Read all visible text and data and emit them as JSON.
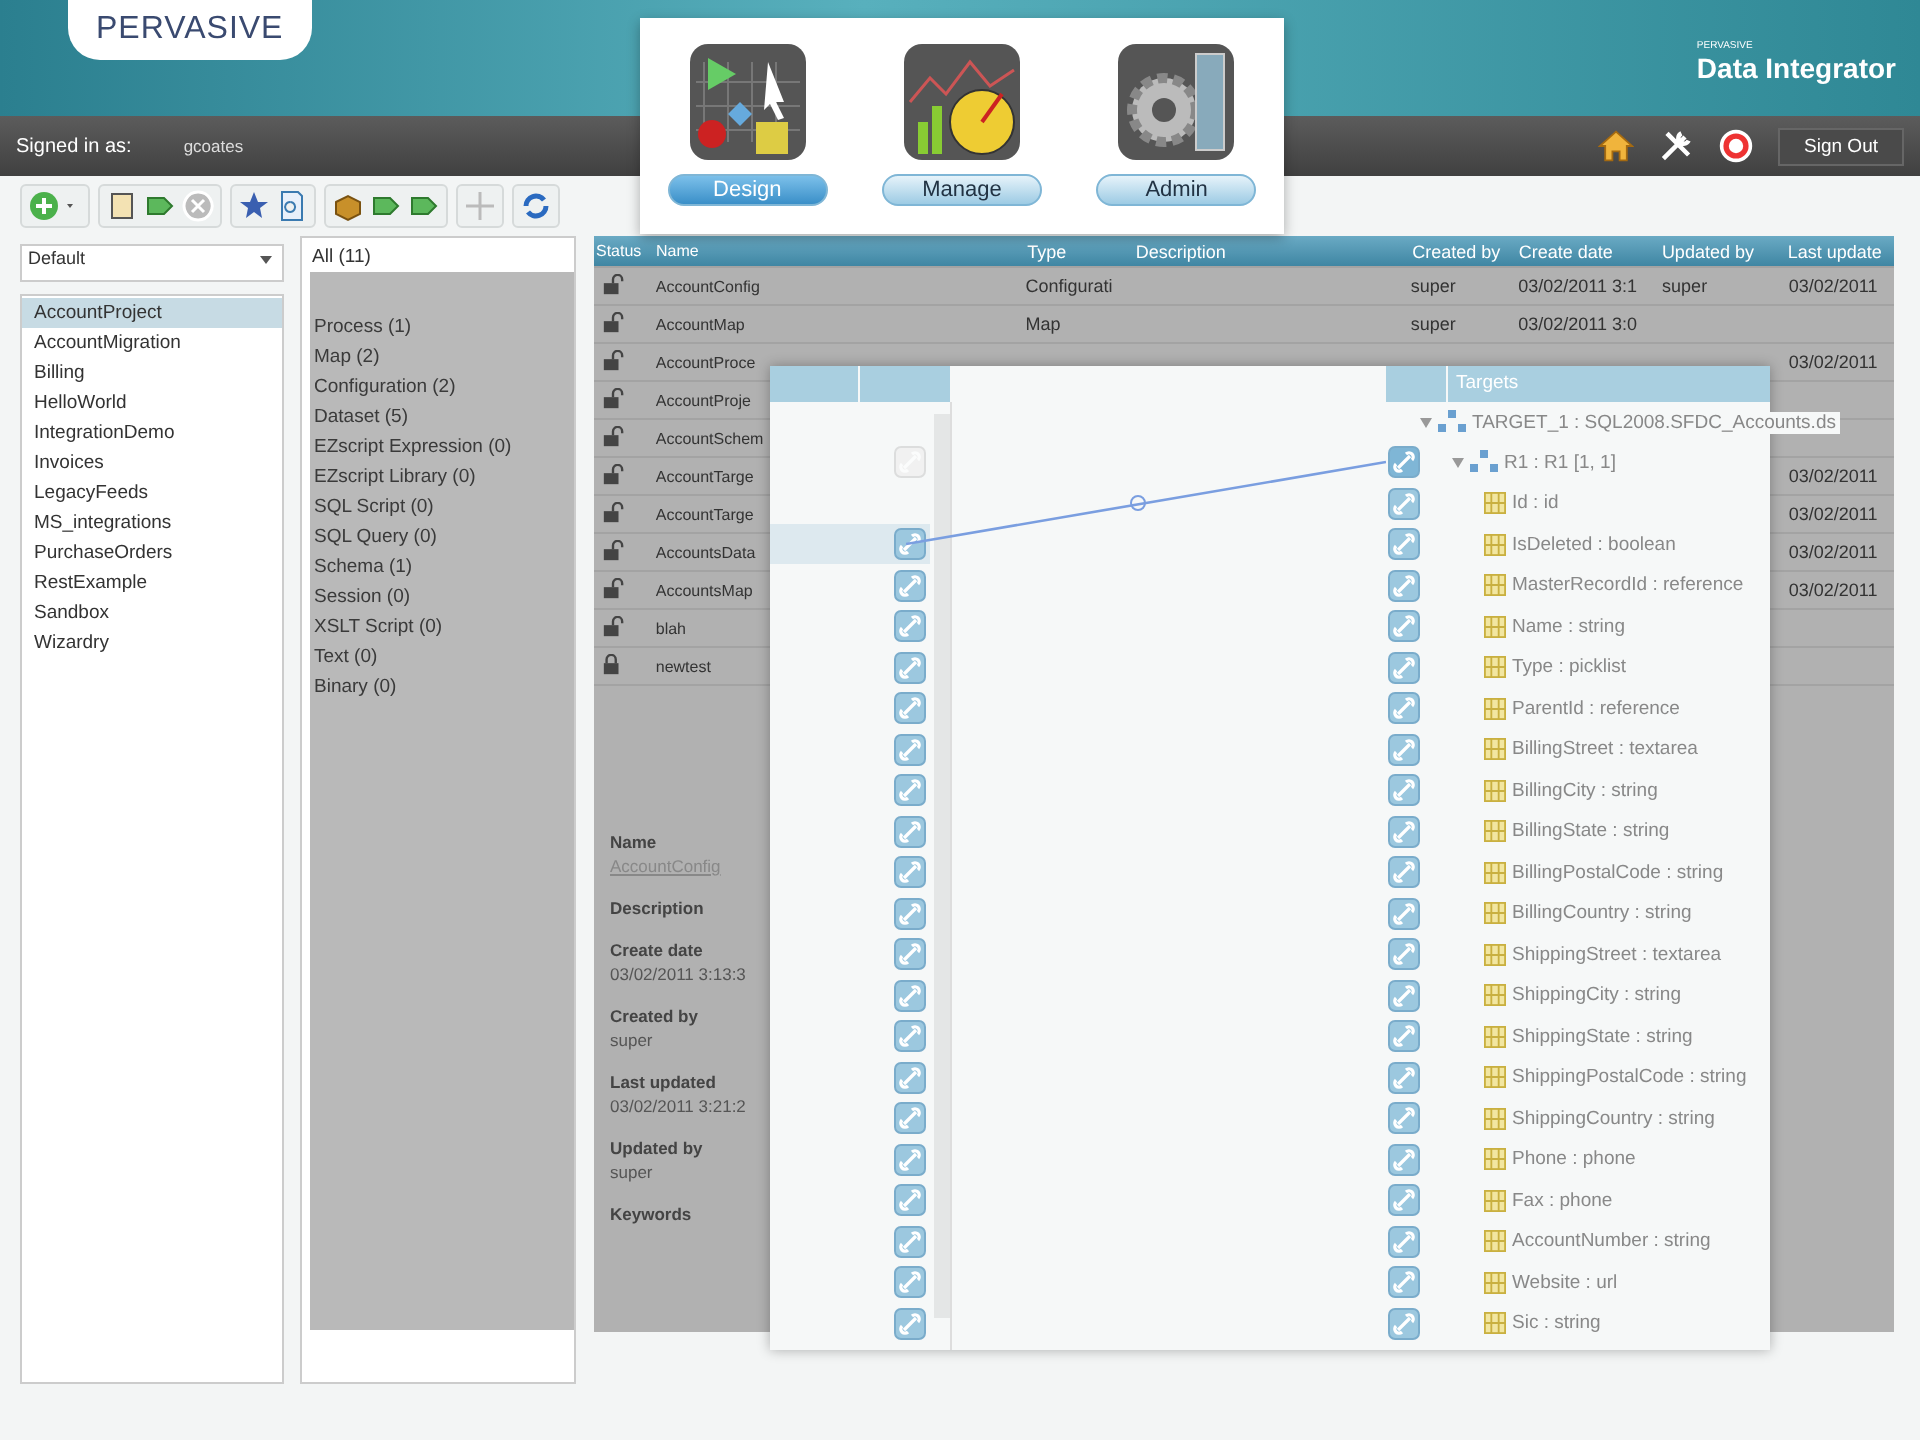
{
  "header": {
    "logo": "PERVASIVE",
    "product_brand": "PERVASIVE",
    "product": "Data Integrator"
  },
  "app_switcher": [
    {
      "label": "Design",
      "kind": "design",
      "selected": true
    },
    {
      "label": "Manage",
      "kind": "manage",
      "selected": false
    },
    {
      "label": "Admin",
      "kind": "admin",
      "selected": false
    }
  ],
  "user_bar": {
    "label": "Signed in as:",
    "user": "gcoates",
    "sign_out": "Sign Out"
  },
  "project_filter": "Default",
  "projects": [
    {
      "label": "AccountProject",
      "selected": true
    },
    {
      "label": "AccountMigration",
      "selected": false
    },
    {
      "label": "Billing",
      "selected": false
    },
    {
      "label": "HelloWorld",
      "selected": false
    },
    {
      "label": "IntegrationDemo",
      "selected": false
    },
    {
      "label": "Invoices",
      "selected": false
    },
    {
      "label": "LegacyFeeds",
      "selected": false
    },
    {
      "label": "MS_integrations",
      "selected": false
    },
    {
      "label": "PurchaseOrders",
      "selected": false
    },
    {
      "label": "RestExample",
      "selected": false
    },
    {
      "label": "Sandbox",
      "selected": false
    },
    {
      "label": "Wizardry",
      "selected": false
    }
  ],
  "categories": {
    "all": "All (11)",
    "items": [
      "Process (1)",
      "Map (2)",
      "Configuration (2)",
      "Dataset (5)",
      "EZscript Expression (0)",
      "EZscript Library (0)",
      "SQL Script (0)",
      "SQL Query (0)",
      "Schema (1)",
      "Session (0)",
      "XSLT Script (0)",
      "Text (0)",
      "Binary (0)"
    ]
  },
  "table": {
    "columns": [
      "Status",
      "Name",
      "Type",
      "Description",
      "Created by",
      "Create date",
      "Updated by",
      "Last update"
    ],
    "rows": [
      {
        "locked": false,
        "name": "AccountConfig",
        "type": "Configurati",
        "created_by": "super",
        "create_date": "03/02/2011 3:1",
        "updated_by": "super",
        "last_updated": "03/02/2011"
      },
      {
        "locked": false,
        "name": "AccountMap",
        "type": "Map",
        "created_by": "super",
        "create_date": "03/02/2011 3:0"
      },
      {
        "locked": false,
        "name": "AccountProce",
        "last_updated": "03/02/2011"
      },
      {
        "locked": false,
        "name": "AccountProje"
      },
      {
        "locked": false,
        "name": "AccountSchem"
      },
      {
        "locked": false,
        "name": "AccountTarge",
        "last_updated": "03/02/2011"
      },
      {
        "locked": false,
        "name": "AccountTarge",
        "last_updated": "03/02/2011"
      },
      {
        "locked": false,
        "name": "AccountsData",
        "last_updated": "03/02/2011"
      },
      {
        "locked": false,
        "name": "AccountsMap",
        "last_updated": "03/02/2011"
      },
      {
        "locked": false,
        "name": "blah"
      },
      {
        "locked": true,
        "name": "newtest"
      }
    ]
  },
  "details": [
    {
      "label": "Name",
      "value": "AccountConfig"
    },
    {
      "label": "Description"
    },
    {
      "label": "Create date",
      "value": "03/02/2011 3:13:3"
    },
    {
      "label": "Created by",
      "value": "super"
    },
    {
      "label": "Last updated",
      "value": "03/02/2011 3:21:2"
    },
    {
      "label": "Updated by",
      "value": "super"
    },
    {
      "label": "Keywords"
    }
  ],
  "mapping": {
    "targets_header": "Targets",
    "source_ports": [
      {
        "kind": "disabled",
        "selected": false
      },
      {
        "kind": "none",
        "selected": false
      },
      {
        "kind": "link",
        "selected": true
      },
      {
        "kind": "link",
        "selected": false
      },
      {
        "kind": "link",
        "selected": false
      },
      {
        "kind": "link",
        "selected": false
      },
      {
        "kind": "link",
        "selected": false
      },
      {
        "kind": "link",
        "selected": false
      },
      {
        "kind": "link",
        "selected": false
      },
      {
        "kind": "link",
        "selected": false
      },
      {
        "kind": "link",
        "selected": false
      },
      {
        "kind": "link",
        "selected": false
      },
      {
        "kind": "link",
        "selected": false
      },
      {
        "kind": "link",
        "selected": false
      },
      {
        "kind": "link",
        "selected": false
      },
      {
        "kind": "link",
        "selected": false
      },
      {
        "kind": "link",
        "selected": false
      },
      {
        "kind": "link",
        "selected": false
      },
      {
        "kind": "link",
        "selected": false
      },
      {
        "kind": "link",
        "selected": false
      },
      {
        "kind": "link",
        "selected": false
      },
      {
        "kind": "link",
        "selected": false
      }
    ],
    "targets": [
      {
        "label": "TARGET_1 : SQL2008.SFDC_Accounts.ds",
        "expanded": true,
        "children": [
          {
            "label": "R1 : R1 [1, 1]",
            "expanded": true,
            "mapped": true,
            "children": [
              {
                "label": "Id : id",
                "mapped": false
              },
              {
                "label": "IsDeleted : boolean",
                "mapped": false
              },
              {
                "label": "MasterRecordId : reference",
                "mapped": false
              },
              {
                "label": "Name : string",
                "mapped": false
              },
              {
                "label": "Type : picklist",
                "mapped": false
              },
              {
                "label": "ParentId : reference",
                "mapped": false
              },
              {
                "label": "BillingStreet : textarea",
                "mapped": false
              },
              {
                "label": "BillingCity : string",
                "mapped": false
              },
              {
                "label": "BillingState : string",
                "mapped": false
              },
              {
                "label": "BillingPostalCode : string",
                "mapped": false
              },
              {
                "label": "BillingCountry : string",
                "mapped": false
              },
              {
                "label": "ShippingStreet : textarea",
                "mapped": false
              },
              {
                "label": "ShippingCity : string",
                "mapped": false
              },
              {
                "label": "ShippingState : string",
                "mapped": false
              },
              {
                "label": "ShippingPostalCode : string",
                "mapped": false
              },
              {
                "label": "ShippingCountry : string",
                "mapped": false
              },
              {
                "label": "Phone : phone",
                "mapped": false
              },
              {
                "label": "Fax : phone",
                "mapped": false
              },
              {
                "label": "AccountNumber : string",
                "mapped": false
              },
              {
                "label": "Website : url",
                "mapped": false
              },
              {
                "label": "Sic : string",
                "mapped": false
              }
            ]
          }
        ]
      }
    ]
  }
}
